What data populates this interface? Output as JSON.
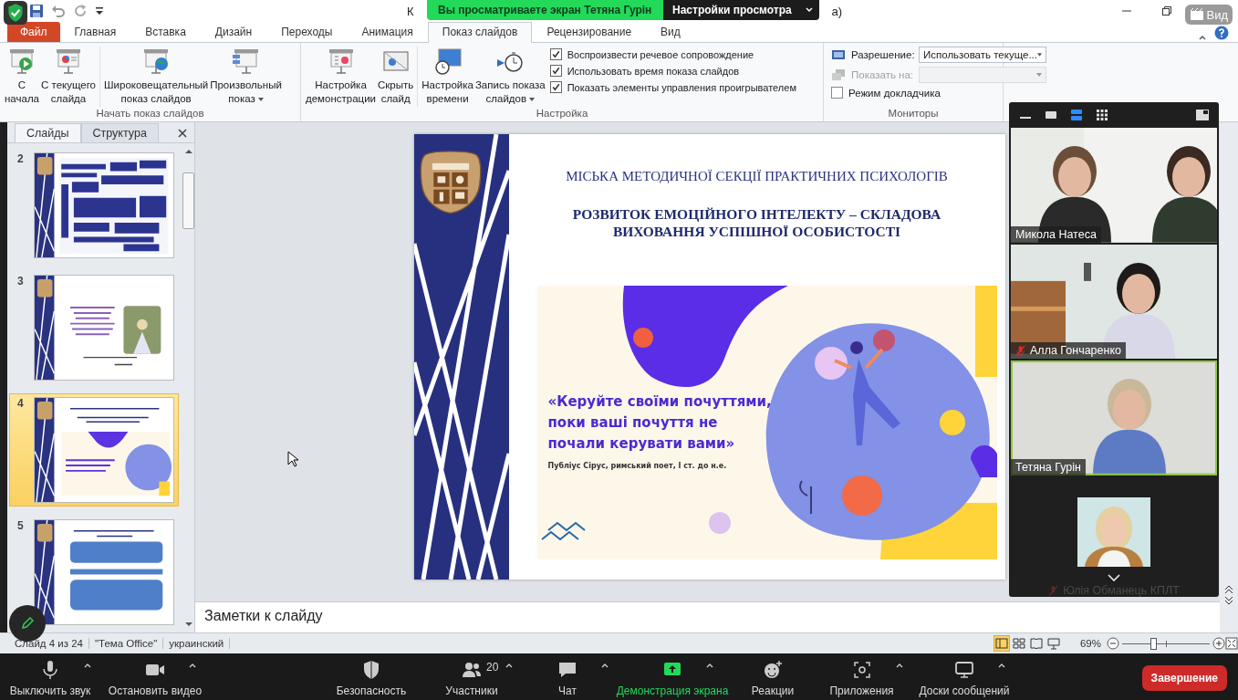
{
  "title_bar": {
    "title_start": "К",
    "title_end": "а)"
  },
  "share_banner": {
    "message": "Вы просматриваете экран Тетяна Гурін",
    "options": "Настройки просмотра"
  },
  "view_button": {
    "label": "Вид"
  },
  "tabs": [
    {
      "label": "Файл",
      "kind": "file",
      "selected": false
    },
    {
      "label": "Главная",
      "kind": "tab",
      "selected": false
    },
    {
      "label": "Вставка",
      "kind": "tab",
      "selected": false
    },
    {
      "label": "Дизайн",
      "kind": "tab",
      "selected": false
    },
    {
      "label": "Переходы",
      "kind": "tab",
      "selected": false
    },
    {
      "label": "Анимация",
      "kind": "tab",
      "selected": false
    },
    {
      "label": "Показ слайдов",
      "kind": "tab",
      "selected": true
    },
    {
      "label": "Рецензирование",
      "kind": "tab",
      "selected": false
    },
    {
      "label": "Вид",
      "kind": "tab",
      "selected": false
    }
  ],
  "ribbon": {
    "start": {
      "label": "Начать показ слайдов",
      "buttons": [
        {
          "lines": [
            "С",
            "начала"
          ],
          "dropdown": false
        },
        {
          "lines": [
            "С текущего",
            "слайда"
          ],
          "dropdown": false
        },
        {
          "lines": [
            "Широковещательный",
            "показ слайдов"
          ],
          "dropdown": false
        },
        {
          "lines": [
            "Произвольный",
            "показ"
          ],
          "dropdown": true
        }
      ]
    },
    "setup": {
      "label": "Настройка",
      "buttons": [
        {
          "lines": [
            "Настройка",
            "демонстрации"
          ],
          "dropdown": false
        },
        {
          "lines": [
            "Скрыть",
            "слайд"
          ],
          "dropdown": false
        },
        {
          "lines": [
            "Настройка",
            "времени"
          ],
          "dropdown": false
        },
        {
          "lines": [
            "Запись показа",
            "слайдов"
          ],
          "dropdown": true
        }
      ],
      "checkboxes": [
        {
          "label": "Воспроизвести речевое сопровождение",
          "checked": true
        },
        {
          "label": "Использовать время показа слайдов",
          "checked": true
        },
        {
          "label": "Показать элементы управления проигрывателем",
          "checked": true
        }
      ]
    },
    "monitors": {
      "label": "Мониторы",
      "resolution": {
        "label": "Разрешение:",
        "value": "Использовать текуще...",
        "disabled": false
      },
      "show_on": {
        "label": "Показать на:",
        "disabled": true
      },
      "presenter_mode": {
        "label": "Режим докладчика",
        "checked": false
      }
    }
  },
  "slides_panel": {
    "tabs": [
      {
        "label": "Слайды",
        "selected": true
      },
      {
        "label": "Структура",
        "selected": false
      }
    ],
    "thumbnails": [
      {
        "number": "2",
        "selected": false
      },
      {
        "number": "3",
        "selected": false
      },
      {
        "number": "4",
        "selected": true
      },
      {
        "number": "5",
        "selected": false
      }
    ]
  },
  "slide": {
    "header": "МІСЬКА МЕТОДИЧНОЇ СЕКЦІЇ ПРАКТИЧНИХ ПСИХОЛОГІВ",
    "title_lines": [
      "РОЗВИТОК ЕМОЦІЙНОГО ІНТЕЛЕКТУ – СКЛАДОВА",
      "ВИХОВАННЯ УСПІШНОЇ ОСОБИСТОСТІ"
    ],
    "quote_lines": [
      "«Керуйте своїми почуттями,",
      "поки ваші почуття не",
      "почали керувати вами»"
    ],
    "attribution": "Публіус Сірус, римський поет, І ст. до н.е."
  },
  "notes": {
    "placeholder": "Заметки к слайду"
  },
  "status_bar": {
    "items": [
      "Слайд 4 из 24",
      "\"Тема Office\"",
      "украинский"
    ],
    "views": [
      {
        "selected": true
      },
      {
        "selected": false
      },
      {
        "selected": false
      },
      {
        "selected": false
      }
    ],
    "zoom": "69%",
    "zoom_slider": {
      "level": 0.34
    }
  },
  "video_panel": {
    "layouts": [
      {
        "selected": false
      },
      {
        "selected": false
      },
      {
        "selected": true
      },
      {
        "selected": false
      }
    ],
    "tiles": [
      {
        "name": "Микола Натеса",
        "kind": "video",
        "muted": false,
        "speaking": false
      },
      {
        "name": "Алла Гончаренко",
        "kind": "video",
        "muted": true,
        "speaking": false
      },
      {
        "name": "Тетяна Гурін",
        "kind": "video",
        "muted": false,
        "speaking": true
      },
      {
        "name": "Юлія Обманець КПЛТ",
        "kind": "avatar",
        "muted": true
      }
    ]
  },
  "meeting_toolbar": {
    "items": [
      {
        "label": "Выключить звук",
        "caret": true,
        "active": false
      },
      {
        "label": "Остановить видео",
        "caret": true,
        "active": false
      },
      {
        "label": "Безопасность",
        "caret": false,
        "active": false
      },
      {
        "label": "Участники",
        "count": "20",
        "caret": true,
        "active": false
      },
      {
        "label": "Чат",
        "caret": true,
        "active": false
      },
      {
        "label": "Демонстрация экрана",
        "caret": true,
        "active": true
      },
      {
        "label": "Реакции",
        "caret": false,
        "active": false
      },
      {
        "label": "Приложения",
        "caret": true,
        "active": false
      },
      {
        "label": "Доски сообщений",
        "caret": true,
        "active": false
      }
    ],
    "end_button": "Завершение"
  }
}
